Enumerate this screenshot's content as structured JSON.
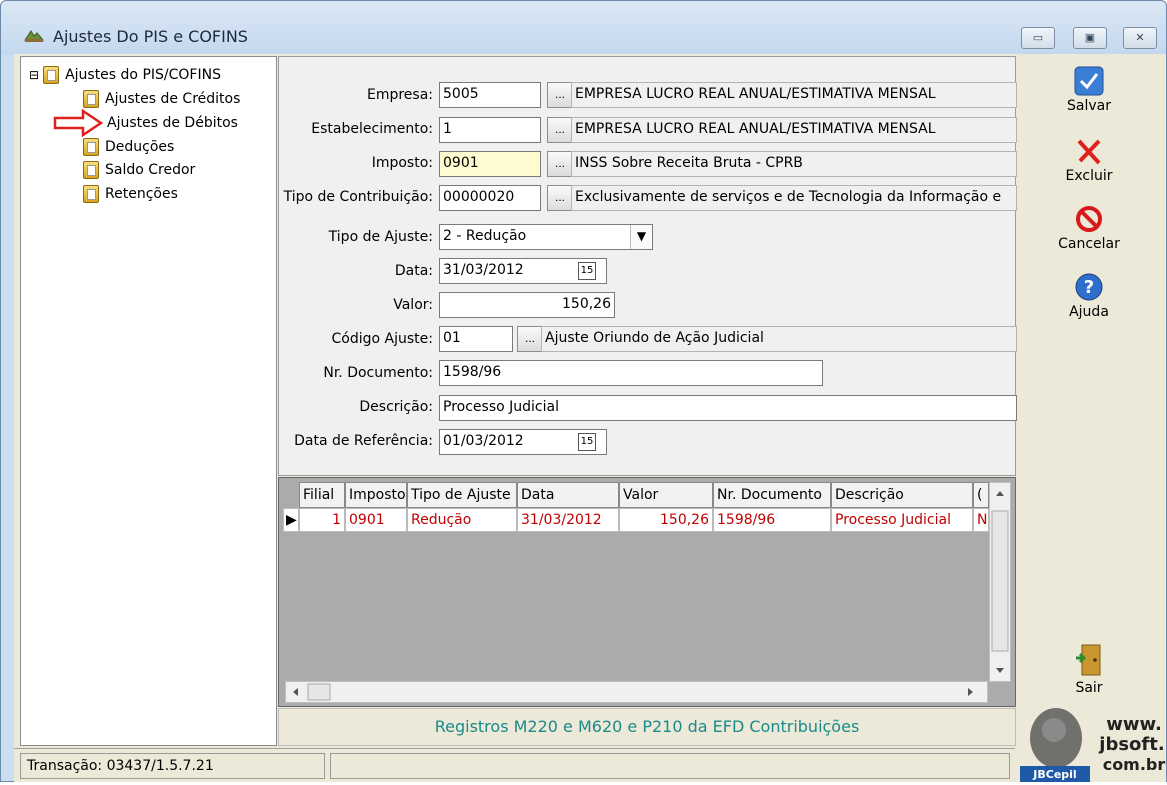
{
  "window": {
    "title": "Ajustes Do PIS e COFINS",
    "minimize": "▭",
    "maximize": "▣",
    "close": "✕"
  },
  "tree": {
    "root": "Ajustes do PIS/COFINS",
    "items": [
      {
        "label": "Ajustes de Créditos"
      },
      {
        "label": "Ajustes de Débitos"
      },
      {
        "label": "Deduções"
      },
      {
        "label": "Saldo Credor"
      },
      {
        "label": "Retenções"
      }
    ],
    "expander": "⊟"
  },
  "form": {
    "empresa": {
      "label": "Empresa:",
      "value": "5005",
      "desc": "EMPRESA LUCRO REAL ANUAL/ESTIMATIVA MENSAL"
    },
    "estabelecimento": {
      "label": "Estabelecimento:",
      "value": "1",
      "desc": "EMPRESA LUCRO REAL ANUAL/ESTIMATIVA MENSAL"
    },
    "imposto": {
      "label": "Imposto:",
      "value": "0901",
      "desc": "INSS Sobre Receita Bruta - CPRB"
    },
    "tipo_contribuicao": {
      "label": "Tipo de Contribuição:",
      "value": "00000020",
      "desc": "Exclusivamente de serviços e de Tecnologia da Informação e"
    },
    "tipo_ajuste": {
      "label": "Tipo de Ajuste:",
      "value": "2 - Redução"
    },
    "data": {
      "label": "Data:",
      "value": "31/03/2012"
    },
    "valor": {
      "label": "Valor:",
      "value": "150,26"
    },
    "codigo_ajuste": {
      "label": "Código Ajuste:",
      "value": "01",
      "desc": "Ajuste Oriundo de Ação Judicial"
    },
    "nr_documento": {
      "label": "Nr. Documento:",
      "value": "1598/96"
    },
    "descricao": {
      "label": "Descrição:",
      "value": "Processo Judicial"
    },
    "data_referencia": {
      "label": "Data de Referência:",
      "value": "01/03/2012"
    },
    "dots": "...",
    "cal": "15",
    "select_arrow": "▼"
  },
  "grid": {
    "columns": [
      "Filial",
      "Imposto",
      "Tipo de Ajuste",
      "Data",
      "Valor",
      "Nr. Documento",
      "Descrição",
      "("
    ],
    "rows": [
      [
        "1",
        "0901",
        "Redução",
        "31/03/2012",
        "150,26",
        "1598/96",
        "Processo Judicial",
        "N"
      ]
    ],
    "row_indicator": "▶"
  },
  "footer": {
    "text": "Registros M220 e M620  e P210 da EFD Contribuições"
  },
  "actions": {
    "salvar": "Salvar",
    "excluir": "Excluir",
    "cancelar": "Cancelar",
    "ajuda": "Ajuda",
    "sair": "Sair"
  },
  "status": {
    "transacao": "Transação: 03437/1.5.7.21"
  },
  "logo": {
    "line1": "www.",
    "line2": "jbsoft.",
    "line3": "com.br",
    "brand": "JBCepil"
  }
}
